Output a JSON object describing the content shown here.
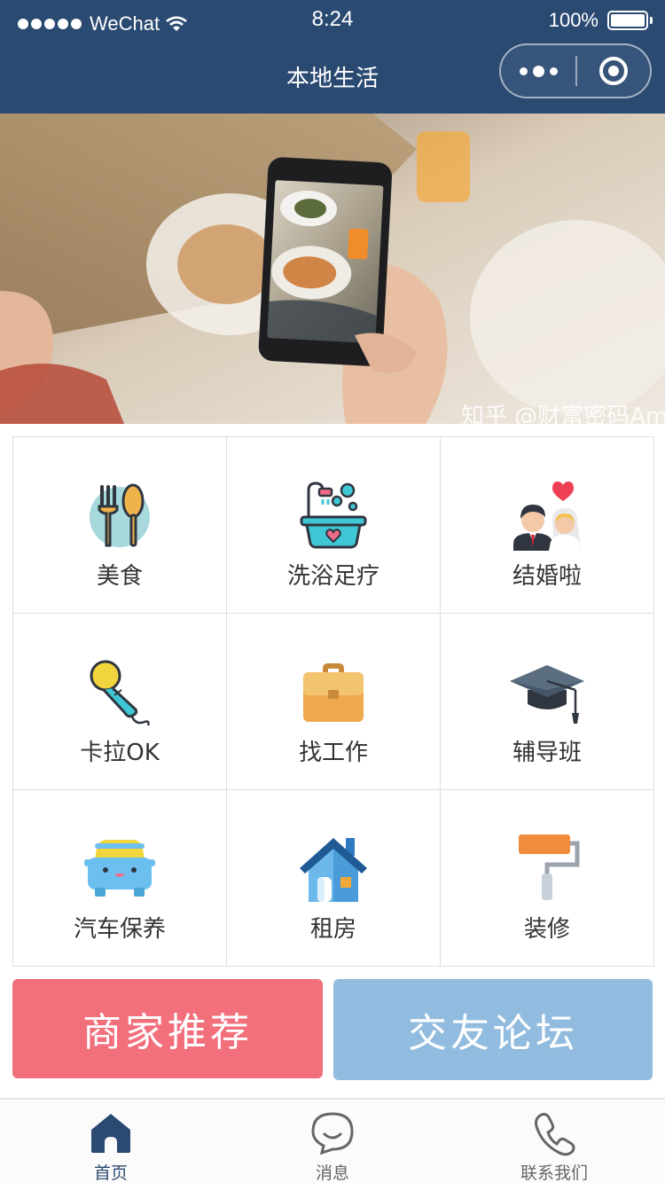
{
  "status_bar": {
    "carrier": "WeChat",
    "time": "8:24",
    "battery": "100%",
    "battery_level": 1.0
  },
  "nav": {
    "title": "本地生活",
    "capsule_icons": [
      "more-dots-icon",
      "target-close-icon"
    ]
  },
  "banner": {
    "description_icon": "banner-photo-phone-food",
    "watermark": "知乎 @财富密码Amy"
  },
  "categories": [
    {
      "label": "美食",
      "icon": "fork-spoon-icon"
    },
    {
      "label": "洗浴足疗",
      "icon": "bathtub-icon"
    },
    {
      "label": "结婚啦",
      "icon": "couple-icon"
    },
    {
      "label": "卡拉OK",
      "icon": "microphone-icon"
    },
    {
      "label": "找工作",
      "icon": "briefcase-icon"
    },
    {
      "label": "辅导班",
      "icon": "graduation-cap-icon"
    },
    {
      "label": "汽车保养",
      "icon": "car-icon"
    },
    {
      "label": "租房",
      "icon": "house-icon"
    },
    {
      "label": "装修",
      "icon": "paint-roller-icon"
    }
  ],
  "actions": {
    "merchant": "商家推荐",
    "forum": "交友论坛"
  },
  "tabbar": [
    {
      "label": "首页",
      "icon": "home-icon",
      "active": true
    },
    {
      "label": "消息",
      "icon": "chat-bubble-icon",
      "active": false
    },
    {
      "label": "联系我们",
      "icon": "phone-icon",
      "active": false
    }
  ],
  "colors": {
    "header": "#2b4a72",
    "merchant_button": "#f26f7c",
    "forum_button": "#92bcdf",
    "tab_active": "#2b4a72"
  }
}
